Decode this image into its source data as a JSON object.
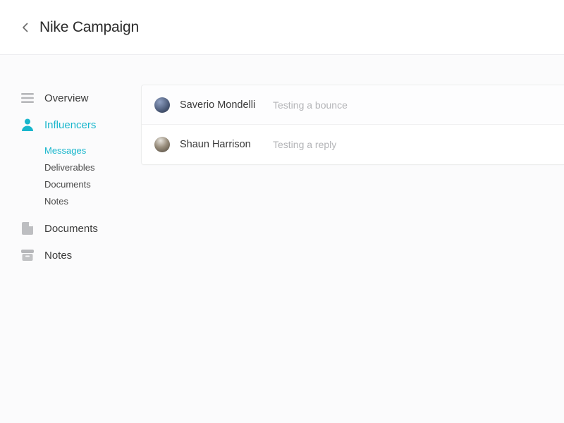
{
  "header": {
    "title": "Nike Campaign"
  },
  "sidebar": {
    "items": [
      {
        "icon": "menu-icon",
        "label": "Overview",
        "active": false
      },
      {
        "icon": "person-icon",
        "label": "Influencers",
        "active": true
      },
      {
        "icon": "document-icon",
        "label": "Documents",
        "active": false
      },
      {
        "icon": "archive-icon",
        "label": "Notes",
        "active": false
      }
    ],
    "sub_items": [
      {
        "label": "Messages",
        "active": true
      },
      {
        "label": "Deliverables",
        "active": false
      },
      {
        "label": "Documents",
        "active": false
      },
      {
        "label": "Notes",
        "active": false
      }
    ]
  },
  "threads": [
    {
      "name": "Saverio Mondelli",
      "preview": "Testing a bounce",
      "selected": false
    },
    {
      "name": "Shaun Harrison",
      "preview": "Testing a reply",
      "selected": true
    }
  ],
  "colors": {
    "accent": "#18b6cc",
    "muted_icon": "#b6b7ba",
    "text": "#2b2b2b",
    "preview": "#b3b4b7"
  }
}
